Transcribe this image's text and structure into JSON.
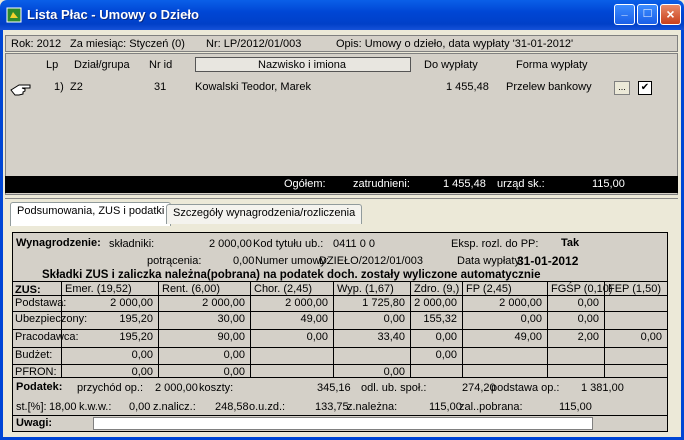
{
  "window": {
    "title": "Lista Płac - Umowy o Dzieło",
    "minimize": "_",
    "maximize": "□",
    "close": "×"
  },
  "info": {
    "rok": "Rok: 2012",
    "miesiac": "Za miesiąc: Styczeń (0)",
    "nr": "Nr: LP/2012/01/003",
    "opis": "Opis:  Umowy o dzieło, data wypłaty '31-01-2012'"
  },
  "grid": {
    "headers": {
      "lp": "Lp",
      "dzial": "Dział/grupa",
      "nrid": "Nr id",
      "nazwisko": "Nazwisko i imiona",
      "do_wyplaty": "Do wypłaty",
      "forma": "Forma wypłaty"
    },
    "rows": [
      {
        "lp": "1)",
        "dzial": "Z2",
        "nrid": "31",
        "nazwisko": "Kowalski Teodor, Marek",
        "do_wyplaty": "1 455,48",
        "forma": "Przelew bankowy",
        "button": "...",
        "checked": "✔"
      }
    ],
    "footer": {
      "ogolem": "Ogółem:",
      "zatrudnieni_label": "zatrudnieni:",
      "zatrudnieni_value": "1 455,48",
      "urzad_label": "urząd sk.:",
      "urzad_value": "115,00"
    }
  },
  "tabs": [
    "Podsumowania, ZUS i podatki",
    "Szczegóły wynagrodzenia/rozliczenia"
  ],
  "summary": {
    "wyn_label": "Wynagrodzenie:",
    "skladniki_label": "składniki:",
    "skladniki_value": "2 000,00",
    "kod_label": "Kod tytułu ub.:",
    "kod_value": "0411 0 0",
    "eksp_label": "Eksp. rozl. do PP:",
    "eksp_value": "Tak",
    "potracenia_label": "potrącenia:",
    "potracenia_value": "0,00",
    "numer_label": "Numer umowy:",
    "numer_value": "DZIEŁO/2012/01/003",
    "data_label": "Data wypłaty:",
    "data_value": "31-01-2012",
    "banner": "Składki ZUS i zaliczka należna(pobrana) na podatek doch. zostały wyliczone automatycznie"
  },
  "zus": {
    "label": "ZUS:",
    "columns": [
      "Emer. (19,52)",
      "Rent. (6,00)",
      "Chor. (2,45)",
      "Wyp. (1,67)",
      "Zdro. (9,)",
      "FP (2,45)",
      "FGŚP (0,10)",
      "FEP (1,50)"
    ],
    "rows": [
      {
        "label": "Podstawa:",
        "values": [
          "2 000,00",
          "2 000,00",
          "2 000,00",
          "1 725,80",
          "2 000,00",
          "2 000,00",
          "0,00",
          ""
        ]
      },
      {
        "label": "Ubezpieczony:",
        "values": [
          "195,20",
          "30,00",
          "49,00",
          "0,00",
          "155,32",
          "0,00",
          "0,00",
          ""
        ]
      },
      {
        "label": "Pracodawca:",
        "values": [
          "195,20",
          "90,00",
          "0,00",
          "33,40",
          "0,00",
          "49,00",
          "2,00",
          "0,00"
        ]
      },
      {
        "label": "Budżet:",
        "values": [
          "0,00",
          "0,00",
          "",
          "",
          "0,00",
          "",
          "",
          ""
        ]
      },
      {
        "label": "PFRON:",
        "values": [
          "0,00",
          "0,00",
          "",
          "0,00",
          "",
          "",
          "",
          ""
        ]
      }
    ]
  },
  "podatek": {
    "label": "Podatek:",
    "przychod_label": "przychód op.:",
    "przychod": "2 000,00",
    "koszty_label": "koszty:",
    "koszty": "345,16",
    "odl_label": "odl. ub. społ.:",
    "odl": "274,20",
    "podstawa_label": "podstawa op.:",
    "podstawa": "1 381,00",
    "st_label": "st.[%]:",
    "st": "18,00",
    "kwa_label": "k.w.w.:",
    "kwa": "0,00",
    "znalicz_label": "z.nalicz.:",
    "znalicz": "248,58",
    "ouzd_label": "o.u.zd.:",
    "ouzd": "133,75",
    "znalezna_label": "z.należna:",
    "znalezna": "115,00",
    "zalpobrana_label": "zal..pobrana:",
    "zalpobrana": "115,00"
  },
  "uwagi": {
    "label": "Uwagi:",
    "value": ""
  }
}
